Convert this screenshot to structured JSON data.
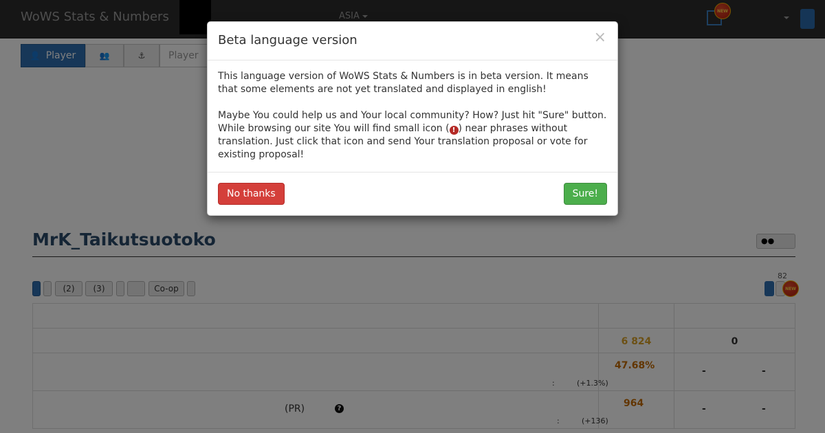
{
  "navbar": {
    "brand": "WoWS Stats & Numbers",
    "region": "ASIA",
    "new_badge": "NEW"
  },
  "search": {
    "player_tab": "Player",
    "player_placeholder": "Player"
  },
  "player": {
    "name": "MrK_Taikutsuotoko"
  },
  "filters": {
    "btn_2": "(2)",
    "btn_3": "(3)",
    "coop": "Co-op",
    "count": "82",
    "new_badge": "NEW"
  },
  "stats": {
    "row1_value": "6 824",
    "row1_right": "0",
    "row2_value": "47.68%",
    "row2_colon": ":",
    "row2_delta": "(+1.3%)",
    "row2_right1": "-",
    "row2_right2": "-",
    "row3_label": "(PR)",
    "row3_help": "?",
    "row3_value": "964",
    "row3_colon": ":",
    "row3_delta": "(+136)",
    "row3_right1": "-",
    "row3_right2": "-"
  },
  "modal": {
    "title": "Beta language version",
    "close": "×",
    "para1": "This language version of WoWS Stats & Numbers is in beta version. It means that some elements are not yet translated and displayed in english!",
    "para2_before": "Maybe You could help us and Your local community? How? Just hit \"Sure\" button. While browsing our site You will find small icon (",
    "para2_icon": "!",
    "para2_after": ") near phrases without translation. Just click that icon and send Your translation proposal or vote for existing proposal!",
    "no_button": "No thanks",
    "yes_button": "Sure!"
  },
  "colors": {
    "navbar_bg": "#2c2c2c",
    "primary": "#2f6eb0",
    "danger": "#d43f3a",
    "success": "#4cae4c",
    "stat_orange": "#c46b00",
    "stat_yellow": "#d8a128"
  }
}
